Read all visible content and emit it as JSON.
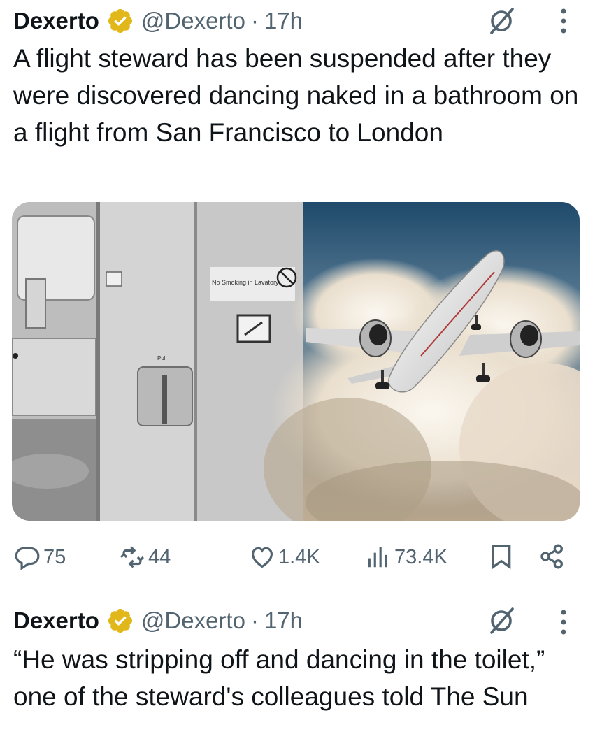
{
  "tweets": [
    {
      "name": "Dexerto",
      "handle": "@Dexerto",
      "separator": "·",
      "time": "17h",
      "text": "A flight steward has been suspended after they were discovered dancing naked in a bathroom on a flight from San Francisco to London",
      "media": {
        "left_image": "airplane-lavatory-photo",
        "right_image": "airplane-in-clouds-photo",
        "lavatory_sign": "No Smoking in Lavatory",
        "door_label": "Pull"
      },
      "actions": {
        "replies": "75",
        "reposts": "44",
        "likes": "1.4K",
        "views": "73.4K"
      }
    },
    {
      "name": "Dexerto",
      "handle": "@Dexerto",
      "separator": "·",
      "time": "17h",
      "text": "“He was stripping off and dancing in the toilet,” one of the steward's colleagues told The Sun"
    }
  ],
  "colors": {
    "text": "#0f1419",
    "secondary": "#536471",
    "verified_gold": "#e2b719"
  },
  "icons": [
    "verified-badge-icon",
    "grok-icon",
    "more-icon",
    "reply-icon",
    "repost-icon",
    "like-icon",
    "views-icon",
    "bookmark-icon",
    "share-icon"
  ]
}
